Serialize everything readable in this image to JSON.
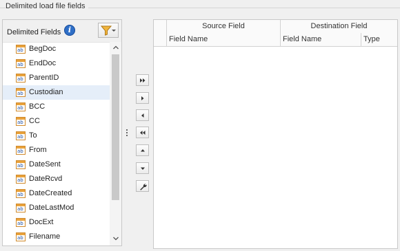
{
  "group": {
    "title": "Delimited load file fields"
  },
  "left_panel": {
    "title": "Delimited Fields",
    "icons": {
      "info": "info-icon",
      "filter": "filter-icon",
      "field": "text-field-icon"
    },
    "field_icon_text": "ab",
    "selected_index": 3,
    "items": [
      "BegDoc",
      "EndDoc",
      "ParentID",
      "Custodian",
      "BCC",
      "CC",
      "To",
      "From",
      "DateSent",
      "DateRcvd",
      "DateCreated",
      "DateLastMod",
      "DocExt",
      "Filename"
    ]
  },
  "move_buttons": [
    {
      "name": "add-all-button",
      "icon": "double-right-arrow-icon"
    },
    {
      "name": "add-button",
      "icon": "right-arrow-icon"
    },
    {
      "name": "remove-button",
      "icon": "left-arrow-icon"
    },
    {
      "name": "remove-all-button",
      "icon": "double-left-arrow-icon"
    },
    {
      "name": "move-up-button",
      "icon": "up-arrow-icon"
    },
    {
      "name": "move-down-button",
      "icon": "down-arrow-icon"
    },
    {
      "name": "settings-button",
      "icon": "wrench-icon"
    }
  ],
  "grid": {
    "bands": {
      "source": "Source Field",
      "destination": "Destination Field"
    },
    "columns": {
      "source_name": "Field Name",
      "dest_name": "Field Name",
      "dest_type": "Type"
    }
  },
  "colors": {
    "selection": "#e5eef9",
    "icon_orange": "#e9a23b",
    "info_blue": "#2f6fc7"
  }
}
